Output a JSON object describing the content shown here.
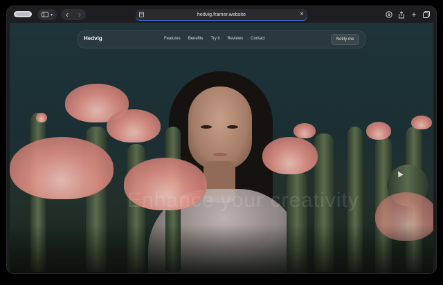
{
  "browser": {
    "url": "hedvig.framer.website",
    "nav_back": "‹",
    "nav_forward": "›",
    "close": "×",
    "toolbar_icons": [
      "download-icon",
      "share-icon",
      "new-tab-icon",
      "tabs-overview-icon"
    ]
  },
  "site": {
    "brand": "Hedvig",
    "nav_links": [
      "Features",
      "Benefits",
      "Try it",
      "Reviews",
      "Contact"
    ],
    "cta": "Notify me",
    "hero_ghost_text": "Enhance your creativity"
  },
  "colors": {
    "nav_background": "#2d3a3e",
    "sky": "#1e3439",
    "flower_pink": "#dc8d83"
  }
}
